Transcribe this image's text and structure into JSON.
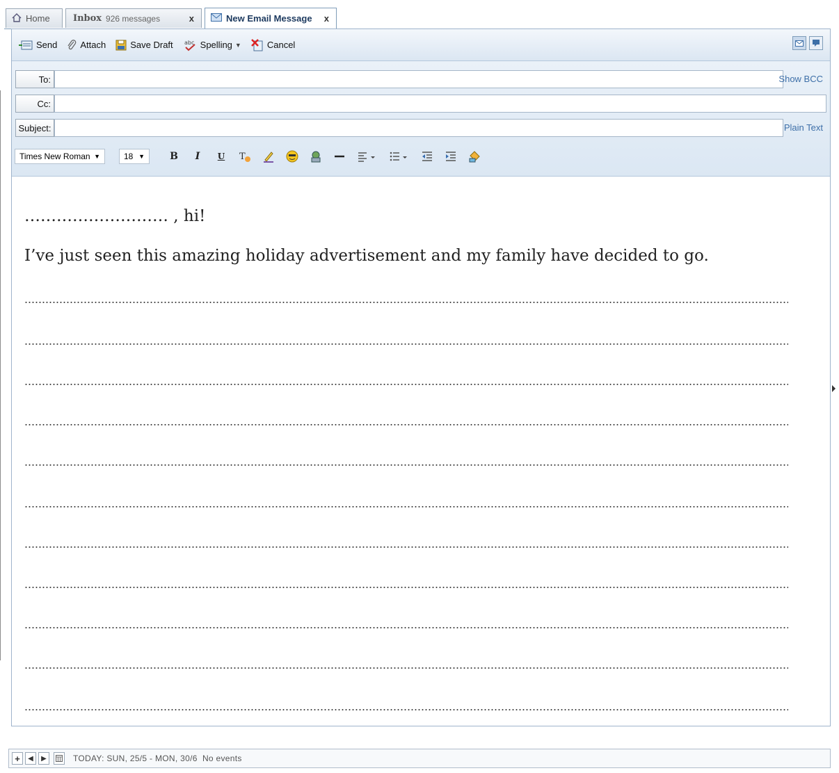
{
  "tabs": [
    {
      "label": "Home"
    },
    {
      "label": "Inbox",
      "sub": "926 messages",
      "close": "x"
    },
    {
      "label": "New Email Message",
      "close": "x"
    }
  ],
  "toolbar": {
    "send": "Send",
    "attach": "Attach",
    "save_draft": "Save Draft",
    "spelling": "Spelling",
    "cancel": "Cancel"
  },
  "headers": {
    "to_label": "To:",
    "cc_label": "Cc:",
    "subject_label": "Subject:",
    "show_bcc": "Show BCC",
    "plain_text": "Plain Text"
  },
  "format": {
    "font": "Times New Roman",
    "size": "18"
  },
  "body": {
    "greeting": "……………………… , hi!",
    "intro": "I’ve just seen this amazing holiday advertisement and my family have decided to go."
  },
  "status": {
    "text": "TODAY: SUN, 25/5 - MON, 30/6  No events"
  },
  "colors": {
    "accent": "#3d6fa8",
    "border": "#9fb4cc",
    "toolbar_bg": "#dbe6f2"
  }
}
